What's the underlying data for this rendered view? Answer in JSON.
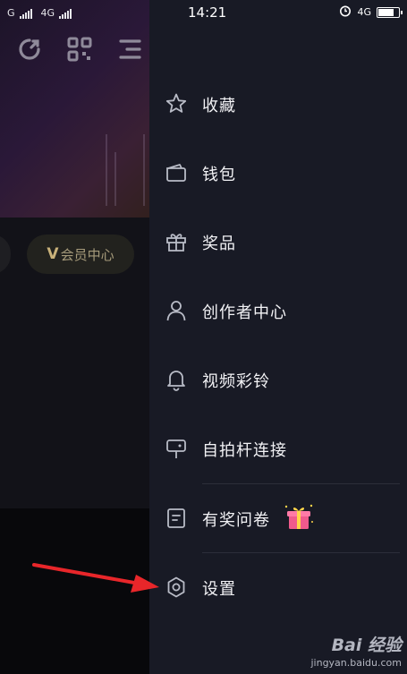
{
  "status_bar": {
    "left_text_1": "G",
    "left_text_2": "4G",
    "time": "14:21",
    "right_network": "4G",
    "battery_level": 0.85
  },
  "background": {
    "vip_badge_letter": "V",
    "vip_label": "会员中心"
  },
  "drawer": {
    "items": [
      {
        "label": "收藏",
        "icon": "star-icon"
      },
      {
        "label": "钱包",
        "icon": "wallet-icon"
      },
      {
        "label": "奖品",
        "icon": "gift-icon"
      },
      {
        "label": "创作者中心",
        "icon": "user-icon"
      },
      {
        "label": "视频彩铃",
        "icon": "bell-icon"
      },
      {
        "label": "自拍杆连接",
        "icon": "selfie-stick-icon"
      },
      {
        "label": "有奖问卷",
        "icon": "survey-icon"
      },
      {
        "label": "设置",
        "icon": "settings-icon"
      }
    ]
  },
  "colors": {
    "drawer_bg": "#181a25",
    "annotation_arrow": "#e8262a"
  },
  "watermark": {
    "logo": "Bai  经验",
    "url": "jingyan.baidu.com"
  }
}
